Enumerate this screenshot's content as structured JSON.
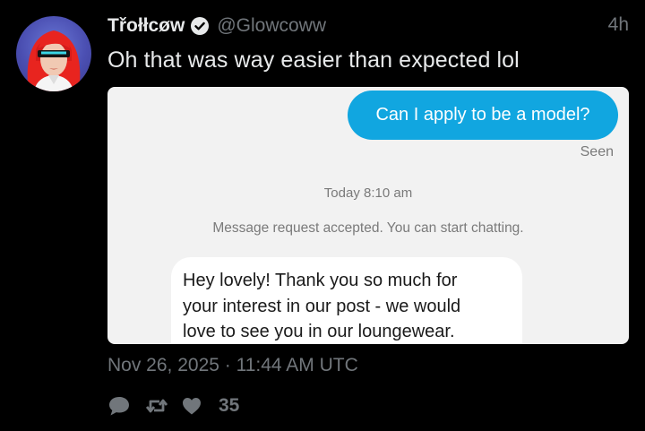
{
  "tweet": {
    "display_name": "Třołłcøw",
    "handle": "@Glowcoww",
    "time_ago": "4h",
    "text": "Oh that was way easier than expected lol",
    "timestamp": "Nov 26, 2025 · 11:44 AM UTC"
  },
  "embedded_chat": {
    "outgoing_message": "Can I apply to be a model?",
    "seen_label": "Seen",
    "date_divider": "Today 8:10 am",
    "system_notice": "Message request accepted. You can start chatting.",
    "incoming_lines": [
      "Hey lovely! Thank you so much for",
      "your interest in our post - we would",
      "love to see you in our loungewear."
    ]
  },
  "actions": {
    "like_count": "35",
    "icons": [
      "reply-icon",
      "retweet-icon",
      "heart-icon"
    ]
  },
  "colors": {
    "background": "#000000",
    "muted_text": "#71767b",
    "primary_text": "#e7e9ea",
    "chat_bubble_blue": "#11a6e0",
    "chat_background": "#f2f2f2"
  }
}
